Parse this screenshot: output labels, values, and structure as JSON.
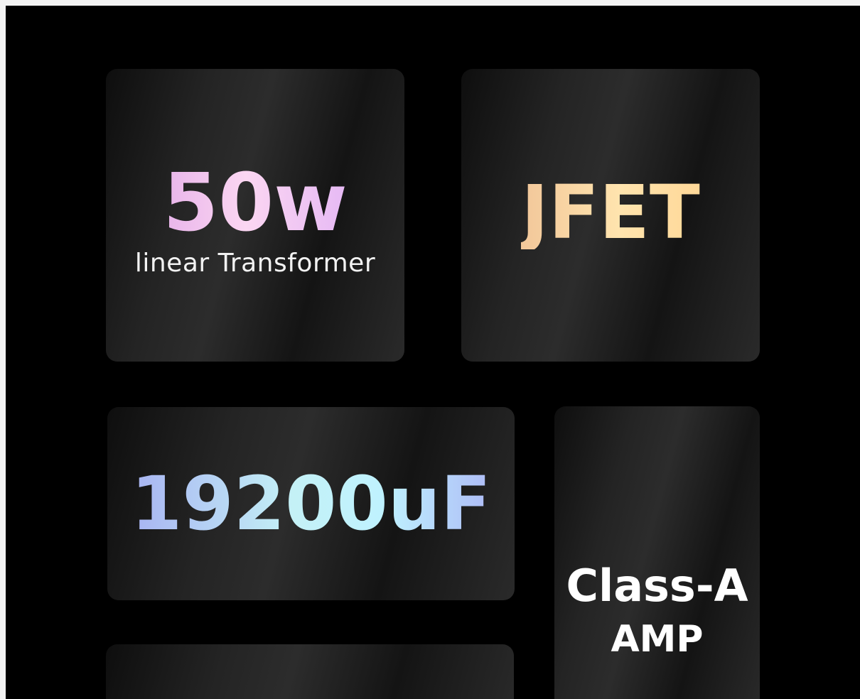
{
  "features": {
    "power": {
      "value": "50w",
      "subtitle": "linear Transformer"
    },
    "jfet": {
      "value": "JFET"
    },
    "capacitance": {
      "value": "19200uF"
    },
    "amp": {
      "line1": "Class-A",
      "line2": "AMP"
    }
  },
  "colors": {
    "background": "#000000",
    "card": "#2a2a2a",
    "power_gradient": [
      "#e8b4ea",
      "#fbd6f2"
    ],
    "jfet_gradient": [
      "#f2c79a",
      "#ffe4ae"
    ],
    "capacitance_gradient": [
      "#a8b4f2",
      "#bff2ff"
    ]
  }
}
